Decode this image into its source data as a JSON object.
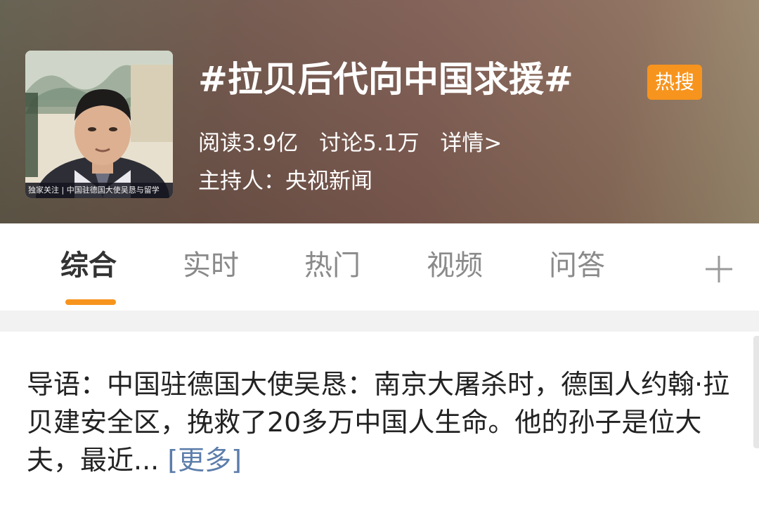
{
  "header": {
    "thumbnail_caption": "独家关注 | 中国驻德国大使吴恳与留学",
    "title": "#拉贝后代向中国求援#",
    "badge": "热搜",
    "reads": "阅读3.9亿",
    "discussions": "讨论5.1万",
    "details_link": "详情>",
    "host": "主持人：央视新闻",
    "badge_color": "#f7941d"
  },
  "tabs": [
    {
      "label": "综合",
      "active": true
    },
    {
      "label": "实时",
      "active": false
    },
    {
      "label": "热门",
      "active": false
    },
    {
      "label": "视频",
      "active": false
    },
    {
      "label": "问答",
      "active": false
    }
  ],
  "tabs_add_icon": "plus-icon",
  "intro": {
    "text": "导语：中国驻德国大使吴恳：南京大屠杀时，德国人约翰·拉贝建安全区，挽救了20多万中国人生命。他的孙子是位大夫，最近...",
    "more_label": "[更多]",
    "more_color": "#5c7dab"
  }
}
